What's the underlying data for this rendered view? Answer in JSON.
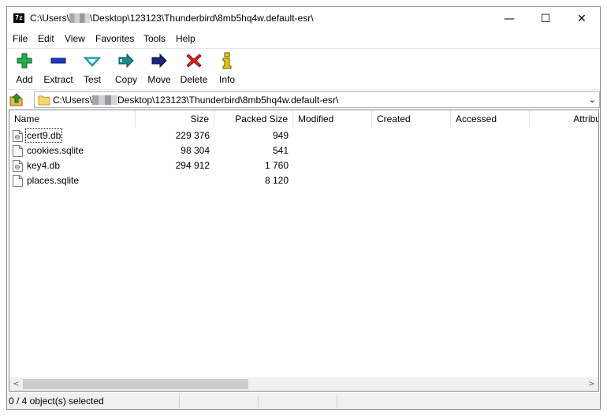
{
  "window": {
    "app_icon_text": "7z",
    "title_prefix": "C:\\Users\\",
    "title_suffix": "\\Desktop\\123123\\Thunderbird\\8mb5hq4w.default-esr\\",
    "minimize_glyph": "—",
    "maximize_glyph": "☐",
    "close_glyph": "✕"
  },
  "menu": [
    "File",
    "Edit",
    "View",
    "Favorites",
    "Tools",
    "Help"
  ],
  "toolbar": {
    "add": "Add",
    "extract": "Extract",
    "test": "Test",
    "copy": "Copy",
    "move": "Move",
    "delete": "Delete",
    "info": "Info",
    "icons": {
      "add": "plus-icon",
      "extract": "minus-icon",
      "test": "check-icon",
      "copy": "copy-arrow-icon",
      "move": "move-arrow-icon",
      "delete": "x-icon",
      "info": "info-icon"
    },
    "colors": {
      "add": "#22b14c",
      "extract": "#1f3bbf",
      "test": "#33c3d8",
      "copy": "#1a8c8c",
      "move": "#1a237e",
      "delete": "#e32020",
      "info": "#e8c800"
    }
  },
  "address": {
    "prefix": "C:\\Users\\",
    "suffix": "Desktop\\123123\\Thunderbird\\8mb5hq4w.default-esr\\",
    "dropdown_glyph": "⌄"
  },
  "columns": {
    "name": "Name",
    "size": "Size",
    "packed_size": "Packed Size",
    "modified": "Modified",
    "created": "Created",
    "accessed": "Accessed",
    "attributes": "Attribute"
  },
  "files": [
    {
      "name": "cert9.db",
      "size": "229 376",
      "packed": "949",
      "icon": "db-file-icon"
    },
    {
      "name": "cookies.sqlite",
      "size": "98 304",
      "packed": "541",
      "icon": "file-icon"
    },
    {
      "name": "key4.db",
      "size": "294 912",
      "packed": "1 760",
      "icon": "db-file-icon"
    },
    {
      "name": "places.sqlite",
      "size": "",
      "packed": "8 120",
      "icon": "file-icon"
    }
  ],
  "scrollbar": {
    "left_glyph": "<",
    "right_glyph": ">"
  },
  "status": {
    "text": "0 / 4 object(s) selected"
  }
}
